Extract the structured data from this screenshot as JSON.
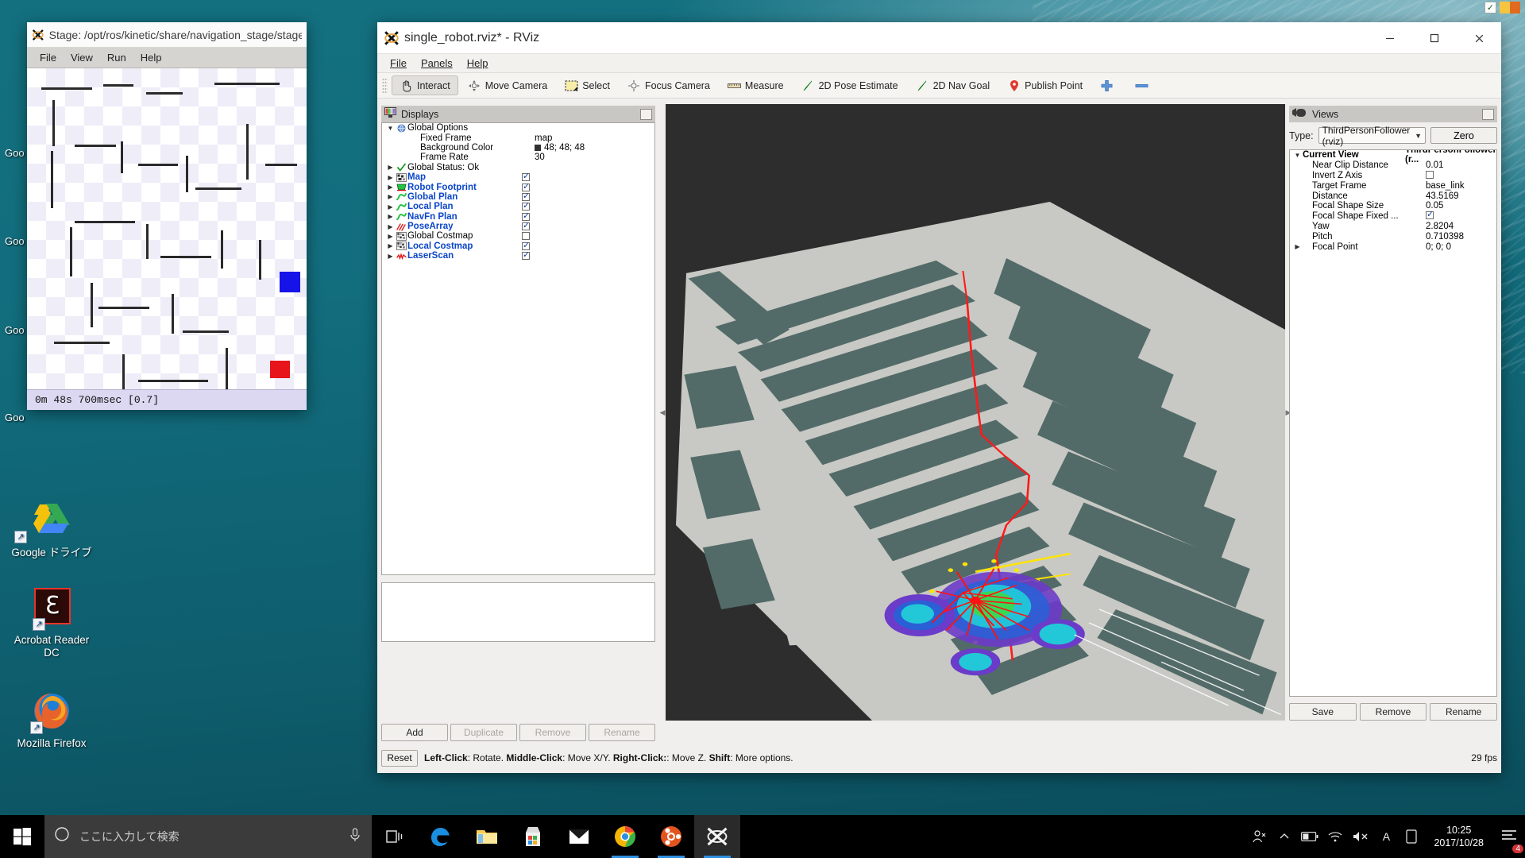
{
  "desktop": {
    "icons": [
      {
        "name": "google-drive",
        "label": "Google ドライブ"
      },
      {
        "name": "acrobat-reader",
        "label": "Acrobat Reader\nDC",
        "line1": "Acrobat Reader",
        "line2": "DC"
      },
      {
        "name": "firefox",
        "label": "Mozilla Firefox"
      }
    ],
    "left_edge_labels": [
      "Goo",
      "Goo",
      "Goo",
      "Goo"
    ]
  },
  "stage_window": {
    "title": "Stage: /opt/ros/kinetic/share/navigation_stage/stage_config",
    "menu": [
      "File",
      "View",
      "Run",
      "Help"
    ],
    "status": "0m 48s 700msec [0.7]"
  },
  "rviz": {
    "title": "single_robot.rviz* - RViz",
    "menu": [
      "File",
      "Panels",
      "Help"
    ],
    "window_buttons": {
      "minimize": "minimize-icon",
      "maximize": "maximize-icon",
      "close": "close-icon"
    },
    "toolbar": [
      {
        "label": "Interact",
        "icon": "hand-cursor-icon",
        "active": true
      },
      {
        "label": "Move Camera",
        "icon": "move-camera-icon",
        "active": false
      },
      {
        "label": "Select",
        "icon": "select-rectangle-icon",
        "active": false
      },
      {
        "label": "Focus Camera",
        "icon": "focus-camera-icon",
        "active": false
      },
      {
        "label": "Measure",
        "icon": "ruler-icon",
        "active": false
      },
      {
        "label": "2D Pose Estimate",
        "icon": "green-arrow-icon",
        "active": false
      },
      {
        "label": "2D Nav Goal",
        "icon": "green-arrow-icon",
        "active": false
      },
      {
        "label": "Publish Point",
        "icon": "map-pin-icon",
        "active": false
      },
      {
        "label": "",
        "icon": "plus-icon",
        "active": false
      },
      {
        "label": "",
        "icon": "minus-icon",
        "active": false
      }
    ],
    "displays": {
      "panel_title": "Displays",
      "panel_icon": "displays-icon",
      "rows": [
        {
          "indent": 0,
          "arrow": "down",
          "icon": "globe-icon",
          "label": "Global Options",
          "bold": false,
          "value": "",
          "check": null
        },
        {
          "indent": 1,
          "arrow": "",
          "icon": "",
          "label": "Fixed Frame",
          "bold": false,
          "value": "map",
          "check": null
        },
        {
          "indent": 1,
          "arrow": "",
          "icon": "",
          "label": "Background Color",
          "bold": false,
          "value": "48; 48; 48",
          "swatch": "#303030",
          "check": null
        },
        {
          "indent": 1,
          "arrow": "",
          "icon": "",
          "label": "Frame Rate",
          "bold": false,
          "value": "30",
          "check": null
        },
        {
          "indent": 0,
          "arrow": "right",
          "icon": "check-icon",
          "label": "Global Status: Ok",
          "bold": false,
          "value": "",
          "check": null
        },
        {
          "indent": 0,
          "arrow": "right",
          "icon": "map-icon",
          "label": "Map",
          "bold": true,
          "value": "",
          "check": true
        },
        {
          "indent": 0,
          "arrow": "right",
          "icon": "footprint-icon",
          "label": "Robot Footprint",
          "bold": true,
          "value": "",
          "check": true
        },
        {
          "indent": 0,
          "arrow": "right",
          "icon": "path-icon",
          "label": "Global Plan",
          "bold": true,
          "value": "",
          "check": true
        },
        {
          "indent": 0,
          "arrow": "right",
          "icon": "path-icon",
          "label": "Local Plan",
          "bold": true,
          "value": "",
          "check": true
        },
        {
          "indent": 0,
          "arrow": "right",
          "icon": "path-icon",
          "label": "NavFn Plan",
          "bold": true,
          "value": "",
          "check": true
        },
        {
          "indent": 0,
          "arrow": "right",
          "icon": "posearray-icon",
          "label": "PoseArray",
          "bold": true,
          "value": "",
          "check": true
        },
        {
          "indent": 0,
          "arrow": "right",
          "icon": "costmap-icon",
          "label": "Global Costmap",
          "bold": false,
          "value": "",
          "check": false
        },
        {
          "indent": 0,
          "arrow": "right",
          "icon": "costmap-icon",
          "label": "Local Costmap",
          "bold": true,
          "value": "",
          "check": true
        },
        {
          "indent": 0,
          "arrow": "right",
          "icon": "laserscan-icon",
          "label": "LaserScan",
          "bold": true,
          "value": "",
          "check": true
        }
      ],
      "buttons": [
        {
          "label": "Add",
          "enabled": true
        },
        {
          "label": "Duplicate",
          "enabled": false
        },
        {
          "label": "Remove",
          "enabled": false
        },
        {
          "label": "Rename",
          "enabled": false
        }
      ]
    },
    "views": {
      "panel_title": "Views",
      "panel_icon": "camera-icon",
      "type_label": "Type:",
      "type_value": "ThirdPersonFollower (rviz)",
      "zero_button": "Zero",
      "tree_header": {
        "key": "Current View",
        "value": "ThirdPersonFollower (r..."
      },
      "rows": [
        {
          "key": "Near Clip Distance",
          "value": "0.01",
          "check": null,
          "arrow": ""
        },
        {
          "key": "Invert Z Axis",
          "value": "",
          "check": false,
          "arrow": ""
        },
        {
          "key": "Target Frame",
          "value": "base_link",
          "check": null,
          "arrow": ""
        },
        {
          "key": "Distance",
          "value": "43.5169",
          "check": null,
          "arrow": ""
        },
        {
          "key": "Focal Shape Size",
          "value": "0.05",
          "check": null,
          "arrow": ""
        },
        {
          "key": "Focal Shape Fixed ...",
          "value": "",
          "check": true,
          "arrow": ""
        },
        {
          "key": "Yaw",
          "value": "2.8204",
          "check": null,
          "arrow": ""
        },
        {
          "key": "Pitch",
          "value": "0.710398",
          "check": null,
          "arrow": ""
        },
        {
          "key": "Focal Point",
          "value": "0; 0; 0",
          "check": null,
          "arrow": "right"
        }
      ],
      "buttons": [
        {
          "label": "Save"
        },
        {
          "label": "Remove"
        },
        {
          "label": "Rename"
        }
      ]
    },
    "statusbar": {
      "reset": "Reset",
      "hint_parts": [
        {
          "t": "Left-Click",
          "b": true
        },
        {
          "t": ": Rotate. ",
          "b": false
        },
        {
          "t": "Middle-Click",
          "b": true
        },
        {
          "t": ": Move X/Y. ",
          "b": false
        },
        {
          "t": "Right-Click:",
          "b": true
        },
        {
          "t": ": Move Z. ",
          "b": false
        },
        {
          "t": "Shift",
          "b": true
        },
        {
          "t": ": More options.",
          "b": false
        }
      ],
      "fps": "29 fps"
    }
  },
  "taskbar": {
    "search_placeholder": "ここに入力して検索",
    "search_icon": "search-circle-icon",
    "mic_icon": "microphone-icon",
    "start_icon": "windows-start-icon",
    "apps": [
      {
        "name": "task-view-icon",
        "running": false
      },
      {
        "name": "edge-icon",
        "running": false
      },
      {
        "name": "file-explorer-icon",
        "running": false
      },
      {
        "name": "microsoft-store-icon",
        "running": false
      },
      {
        "name": "mail-icon",
        "running": false
      },
      {
        "name": "chrome-icon",
        "running": true
      },
      {
        "name": "ubuntu-icon",
        "running": true
      },
      {
        "name": "xming-icon",
        "running": true,
        "active": true
      }
    ],
    "tray": [
      "people-icon",
      "show-hidden-icons-chevron",
      "battery-icon",
      "wifi-icon",
      "volume-mute-icon",
      "ime-A-icon",
      "ime-mode-icon"
    ],
    "clock": {
      "time": "10:25",
      "date": "2017/10/28"
    },
    "notification_icon": "action-center-icon",
    "notification_count": "4"
  },
  "colors": {
    "accent_blue": "#0a46c8",
    "panel_bg": "#f0efed",
    "titlebar_gray": "#c9c7c3",
    "render_bg": "#2d2d2d",
    "map_gray": "#c8c9c4",
    "map_dark": "#536b68",
    "path_red": "#ff1a1a",
    "taskbar_bg": "#000000"
  }
}
